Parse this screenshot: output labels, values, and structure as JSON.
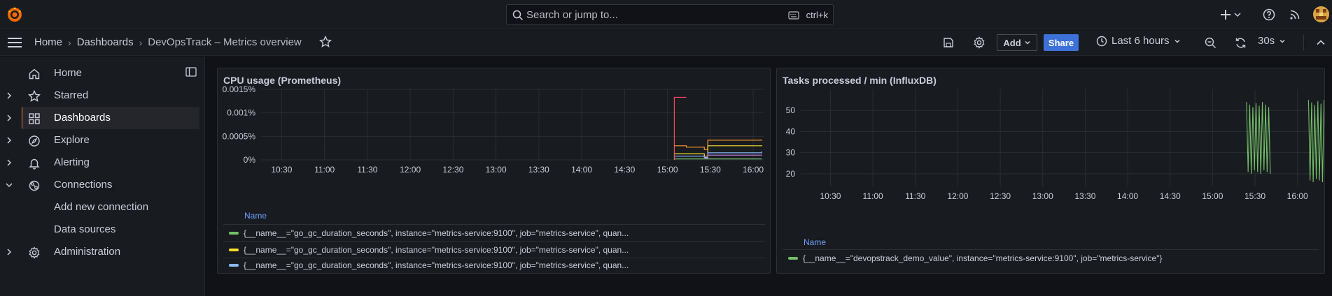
{
  "search": {
    "placeholder": "Search or jump to...",
    "shortcut": "ctrl+k"
  },
  "breadcrumb": [
    {
      "label": "Home"
    },
    {
      "label": "Dashboards"
    },
    {
      "label": "DevOpsTrack – Metrics overview"
    }
  ],
  "toolbar": {
    "add_label": "Add",
    "share_label": "Share",
    "time_range": "Last 6 hours",
    "refresh_interval": "30s"
  },
  "sidebar": {
    "items": [
      {
        "label": "Home",
        "icon": "home-icon"
      },
      {
        "label": "Starred",
        "icon": "star-icon"
      },
      {
        "label": "Dashboards",
        "icon": "dashboards-icon",
        "active": true
      },
      {
        "label": "Explore",
        "icon": "compass-icon"
      },
      {
        "label": "Alerting",
        "icon": "bell-icon"
      },
      {
        "label": "Connections",
        "icon": "connections-icon",
        "expanded": true
      },
      {
        "label": "Administration",
        "icon": "gear-icon"
      }
    ],
    "sub_items": [
      {
        "label": "Add new connection"
      },
      {
        "label": "Data sources"
      }
    ]
  },
  "panels": {
    "cpu": {
      "title": "CPU usage (Prometheus)",
      "legend_header": "Name",
      "legend": [
        {
          "label": "{__name__=\"go_gc_duration_seconds\", instance=\"metrics-service:9100\", job=\"metrics-service\", quan...",
          "color": "#73bf69"
        },
        {
          "label": "{__name__=\"go_gc_duration_seconds\", instance=\"metrics-service:9100\", job=\"metrics-service\", quan...",
          "color": "#fade2a"
        },
        {
          "label": "{__name__=\"go_gc_duration_seconds\", instance=\"metrics-service:9100\", job=\"metrics-service\", quan...",
          "color": "#8ab8ff"
        }
      ]
    },
    "tasks": {
      "title": "Tasks processed / min (InfluxDB)",
      "legend_header": "Name",
      "legend": [
        {
          "label": "{__name__=\"devopstrack_demo_value\", instance=\"metrics-service:9100\", job=\"metrics-service\"}",
          "color": "#73bf69"
        }
      ]
    }
  },
  "chart_data": [
    {
      "type": "line",
      "title": "CPU usage (Prometheus)",
      "x_ticks": [
        "10:30",
        "11:00",
        "11:30",
        "12:00",
        "12:30",
        "13:00",
        "13:30",
        "14:00",
        "14:30",
        "15:00",
        "15:30",
        "16:00"
      ],
      "y_ticks": [
        "0%",
        "0.0005%",
        "0.001%",
        "0.0015%"
      ],
      "ylim": [
        0,
        0.0015
      ],
      "grid": true,
      "legend_placement": "bottom",
      "series": [
        {
          "color": "#f2495c",
          "points": [
            [
              15.08,
              0
            ],
            [
              15.08,
              0.00133
            ],
            [
              15.22,
              0.00133
            ]
          ]
        },
        {
          "color": "#ff9830",
          "points": [
            [
              15.08,
              0.0003
            ],
            [
              15.22,
              0.00027
            ],
            [
              15.43,
              0.00022
            ],
            [
              15.47,
              0.00042
            ],
            [
              16.1,
              0.00043
            ]
          ]
        },
        {
          "color": "#fade2a",
          "points": [
            [
              15.08,
              0.00013
            ],
            [
              15.22,
              0.00013
            ],
            [
              15.43,
              8e-05
            ],
            [
              15.47,
              0.0003
            ],
            [
              16.1,
              0.00031
            ]
          ]
        },
        {
          "color": "#8ab8ff",
          "points": [
            [
              15.08,
              8e-05
            ],
            [
              15.22,
              8e-05
            ],
            [
              15.43,
              5e-05
            ],
            [
              15.47,
              0.00015
            ],
            [
              16.1,
              0.00018
            ]
          ]
        },
        {
          "color": "#b877d9",
          "points": [
            [
              15.43,
              4e-05
            ],
            [
              15.47,
              0.0001
            ],
            [
              16.1,
              0.00011
            ]
          ]
        },
        {
          "color": "#73bf69",
          "points": [
            [
              15.08,
              2e-05
            ],
            [
              15.22,
              2e-05
            ],
            [
              15.47,
              2e-05
            ],
            [
              16.1,
              2e-05
            ]
          ]
        }
      ]
    },
    {
      "type": "line",
      "title": "Tasks processed / min (InfluxDB)",
      "x_ticks": [
        "10:30",
        "11:00",
        "11:30",
        "12:00",
        "12:30",
        "13:00",
        "13:30",
        "14:00",
        "14:30",
        "15:00",
        "15:30",
        "16:00"
      ],
      "y_ticks": [
        "20",
        "30",
        "40",
        "50"
      ],
      "ylim": [
        14,
        60
      ],
      "grid": true,
      "legend_placement": "bottom",
      "series": [
        {
          "color": "#73bf69",
          "oscillating_bursts": [
            {
              "x_start": 15.4,
              "x_end": 15.68,
              "low": 20,
              "high": 54
            },
            {
              "x_start": 16.13,
              "x_end": 16.68,
              "low": 16,
              "high": 55
            }
          ]
        }
      ]
    }
  ]
}
